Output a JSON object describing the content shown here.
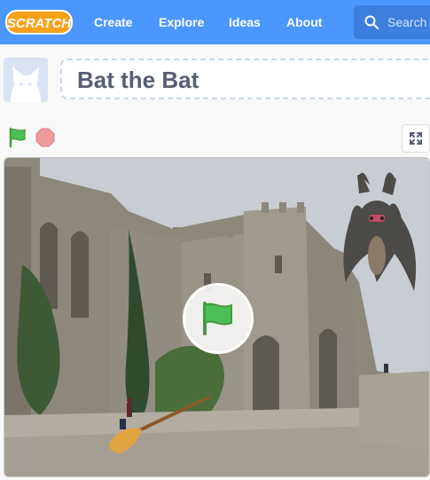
{
  "nav": {
    "logo_text": "SCRATCH",
    "links": [
      "Create",
      "Explore",
      "Ideas",
      "About"
    ],
    "search_placeholder": "Search"
  },
  "project": {
    "title": "Bat the Bat"
  },
  "colors": {
    "nav": "#4c97ff",
    "search": "#3c7fde",
    "title_text": "#575e75",
    "flag_green": "#4cbf56",
    "stop_red": "#ec9c9c",
    "logo_orange": "#f7a21a"
  },
  "icons": {
    "search": "search-icon",
    "flag": "green-flag-icon",
    "stop": "stop-icon",
    "fullscreen": "fullscreen-icon"
  }
}
